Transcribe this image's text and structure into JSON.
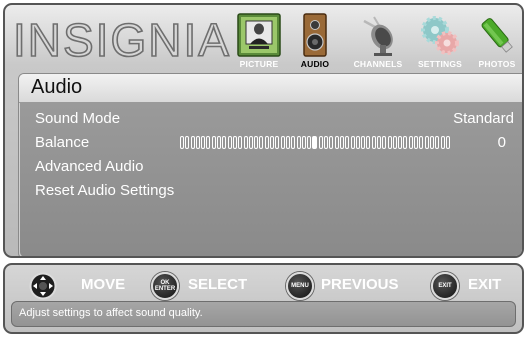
{
  "brand": {
    "logo_text": "INSIGNIA"
  },
  "tabs": [
    {
      "label": "PICTURE",
      "icon": "picture-icon",
      "active": false
    },
    {
      "label": "AUDIO",
      "icon": "speaker-icon",
      "active": true
    },
    {
      "label": "CHANNELS",
      "icon": "satellite-dish-icon",
      "active": false
    },
    {
      "label": "SETTINGS",
      "icon": "gears-icon",
      "active": false
    },
    {
      "label": "PHOTOS",
      "icon": "usb-drive-icon",
      "active": false
    }
  ],
  "panel": {
    "title": "Audio",
    "items": [
      {
        "label": "Sound Mode",
        "value": "Standard"
      },
      {
        "label": "Balance",
        "value": "0",
        "slider_position": 0.5
      },
      {
        "label": "Advanced Audio"
      },
      {
        "label": "Reset Audio Settings"
      }
    ]
  },
  "footer": {
    "hints": [
      {
        "key_text": "",
        "label": "MOVE",
        "icon": "dpad-icon"
      },
      {
        "key_text": "OK ENTER",
        "label": "SELECT",
        "icon": "ok-enter-button-icon"
      },
      {
        "key_text": "MENU",
        "label": "PREVIOUS",
        "icon": "menu-button-icon"
      },
      {
        "key_text": "EXIT",
        "label": "EXIT",
        "icon": "exit-button-icon"
      }
    ],
    "help_text": "Adjust settings to affect sound quality."
  },
  "colors": {
    "panel_row_bg": "#8e8e8e",
    "frame_border": "#555555",
    "text_light": "#ffffff"
  }
}
